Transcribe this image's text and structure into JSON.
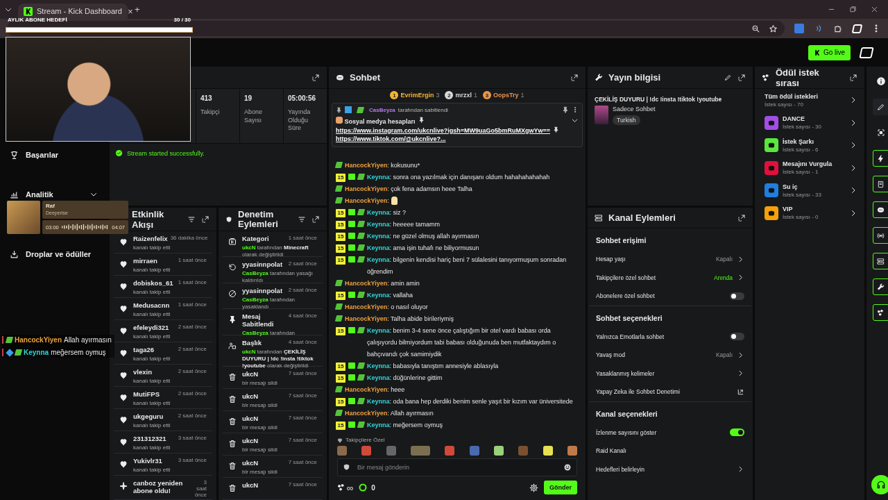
{
  "browser": {
    "tab_title": "Stream - Kick Dashboard",
    "tab_close": "×",
    "new_tab": "+"
  },
  "header": {
    "go_live": "Go live"
  },
  "overlays": {
    "goal": {
      "title": "AYLIK ABONE HEDEFİ",
      "count": "30 / 30",
      "level": 1
    },
    "music": {
      "title": "Raf",
      "artist": "Deeperise",
      "elapsed": "03:00",
      "total": "04:07"
    },
    "chat": [
      {
        "user": "HancockYiyen",
        "text": "Allah ayırmasın",
        "kind": "follower",
        "color": "#f0a23c"
      },
      {
        "user": "Keynna",
        "text": "meğersem oymuş",
        "kind": "subscriber",
        "color": "#33d6d6"
      }
    ]
  },
  "sidebar": {
    "items": [
      {
        "label": "Başarılar",
        "kind": "trophy",
        "expandable": false
      },
      {
        "label": "Analitik",
        "kind": "chart",
        "expandable": true
      },
      {
        "label": "Droplar ve ödüller",
        "kind": "drops",
        "expandable": false
      }
    ]
  },
  "stats": {
    "items": [
      {
        "value": "413",
        "label": "Takipçi"
      },
      {
        "value": "19",
        "label": "Abone Sayısı"
      },
      {
        "value": "05:00:56",
        "label": "Yayında Olduğu Süre"
      }
    ],
    "notice": "Stream started successfully."
  },
  "activity": {
    "title": "Etkinlik Akışı",
    "items": [
      {
        "kind": "follow",
        "name": "Raizenfelix",
        "desc": "kanalı takip etti",
        "time": "36 dakika önce"
      },
      {
        "kind": "follow",
        "name": "mirraen",
        "desc": "kanalı takip etti",
        "time": "1 saat önce"
      },
      {
        "kind": "follow",
        "name": "dobiskos_61",
        "desc": "kanalı takip etti",
        "time": "1 saat önce"
      },
      {
        "kind": "follow",
        "name": "Medusacnn",
        "desc": "kanalı takip etti",
        "time": "1 saat önce"
      },
      {
        "kind": "follow",
        "name": "efeleydi321",
        "desc": "kanalı takip etti",
        "time": "2 saat önce"
      },
      {
        "kind": "follow",
        "name": "taga26",
        "desc": "kanalı takip etti",
        "time": "2 saat önce"
      },
      {
        "kind": "follow",
        "name": "vlexin",
        "desc": "kanalı takip etti",
        "time": "2 saat önce"
      },
      {
        "kind": "follow",
        "name": "MutiFPS",
        "desc": "kanalı takip etti",
        "time": "2 saat önce"
      },
      {
        "kind": "follow",
        "name": "ukgeguru",
        "desc": "kanalı takip etti",
        "time": "2 saat önce"
      },
      {
        "kind": "follow",
        "name": "231312321",
        "desc": "kanalı takip etti",
        "time": "3 saat önce"
      },
      {
        "kind": "follow",
        "name": "Yukivlr31",
        "desc": "kanalı takip etti",
        "time": "3 saat önce"
      },
      {
        "kind": "resub",
        "name": "canboz yeniden abone oldu!",
        "time": "3 saat önce"
      }
    ]
  },
  "moderation": {
    "title": "Denetim Eylemleri",
    "items": [
      {
        "kind": "category",
        "title": "Kategori",
        "desc": "**ukcN** tarafından **Minecraft** olarak değiştirildi",
        "time": "1 saat önce"
      },
      {
        "kind": "unban",
        "title": "yyasinnpolat",
        "desc": "**CasBeyza** tarafından yasağı kaldırıldı",
        "time": "2 saat önce"
      },
      {
        "kind": "ban",
        "title": "yyasinnpolat",
        "desc": "**CasBeyza** tarafından yasaklandı",
        "time": "2 saat önce"
      },
      {
        "kind": "pin",
        "title": "Mesaj Sabitlendi",
        "desc": "**CasBeyza** tarafından",
        "time": "4 saat önce"
      },
      {
        "kind": "title",
        "title": "Başlık",
        "desc": "**ukcN** tarafından **ÇEKİLİŞ DUYURU | !dc !insta !tiktok !youtube** olarak değiştirildi",
        "time": "4 saat önce"
      },
      {
        "kind": "delete",
        "title": "ukcN",
        "desc": "bir mesajı sildi",
        "time": "7 saat önce"
      },
      {
        "kind": "delete",
        "title": "ukcN",
        "desc": "bir mesajı sildi",
        "time": "7 saat önce"
      },
      {
        "kind": "delete",
        "title": "ukcN",
        "desc": "bir mesajı sildi",
        "time": "7 saat önce"
      },
      {
        "kind": "delete",
        "title": "ukcN",
        "desc": "bir mesajı sildi",
        "time": "7 saat önce"
      },
      {
        "kind": "delete",
        "title": "ukcN",
        "desc": "bir mesajı sildi",
        "time": "7 saat önce"
      },
      {
        "kind": "delete",
        "title": "ukcN",
        "time": "7 saat önce"
      }
    ]
  },
  "chat": {
    "title": "Sohbet",
    "leaders": [
      {
        "rank": "1",
        "name": "EvrimErgin",
        "count": "3",
        "color": "#f5b731"
      },
      {
        "rank": "2",
        "name": "mrzxl",
        "count": "1",
        "color": "#d8d8d8"
      },
      {
        "rank": "3",
        "name": "OopsTry",
        "count": "1",
        "color": "#e8954a"
      }
    ],
    "pinned": {
      "by": "CasBeyza",
      "note": "tarafından sabitlendi",
      "label": "Sosyal medya hesapları",
      "links": [
        "https://www.instagram.com/ukcnlive?igsh=MW9uaGo5bmRuMXgwYw==",
        "https://www.tiktok.com/@ukcnlive?..."
      ]
    },
    "messages": [
      {
        "user": "HancockYiyen",
        "sep": ":",
        "text": "kokusunu*",
        "kind": "follower",
        "color": "#f0a23c"
      },
      {
        "badge": "15",
        "user": "Keynna",
        "sep": ":",
        "text": "sonra ona yazılmak için danışanı oldum hahahahahahah",
        "kind": "subscriber",
        "color": "#33d6d6"
      },
      {
        "user": "HancockYiyen",
        "sep": ":",
        "text": "çok fena adamsın heee Talha",
        "kind": "follower",
        "color": "#f0a23c"
      },
      {
        "user": "HancockYiyen",
        "sep": ":",
        "kind": "emote",
        "color": "#f0a23c"
      },
      {
        "badge": "15",
        "user": "Keynna",
        "sep": ":",
        "text": "siz ?",
        "kind": "subscriber",
        "color": "#33d6d6"
      },
      {
        "badge": "15",
        "user": "Keynna",
        "sep": ":",
        "text": "heeeee tamamm",
        "kind": "subscriber",
        "color": "#33d6d6"
      },
      {
        "badge": "15",
        "user": "Keynna",
        "sep": ":",
        "text": "ne güzel olmuş allah ayırmasın",
        "kind": "subscriber",
        "color": "#33d6d6"
      },
      {
        "badge": "15",
        "user": "Keynna",
        "sep": ":",
        "text": "ama işin tuhafı ne biliyormusun",
        "kind": "subscriber",
        "color": "#33d6d6"
      },
      {
        "badge": "15",
        "user": "Keynna",
        "sep": ":",
        "text": "bilgenin kendisi hariç beni 7 sülalesini tanıyormuşum sonradan öğrendim",
        "kind": "subscriber",
        "color": "#33d6d6"
      },
      {
        "user": "HancockYiyen",
        "sep": ":",
        "text": "amin amin",
        "kind": "follower",
        "color": "#f0a23c"
      },
      {
        "badge": "15",
        "user": "Keynna",
        "sep": ":",
        "text": "vallaha",
        "kind": "subscriber",
        "color": "#33d6d6"
      },
      {
        "user": "HancockYiyen",
        "sep": ":",
        "text": "o nasıl oluyor",
        "kind": "follower",
        "color": "#f0a23c"
      },
      {
        "user": "HancockYiyen",
        "sep": ":",
        "text": "Talha abide birileriymiş",
        "kind": "follower",
        "color": "#f0a23c"
      },
      {
        "badge": "15",
        "user": "Keynna",
        "sep": ":",
        "text": "benim 3-4 sene önce çalıştığım bir otel vardı babası orda çalışıyordu bilmiyordum tabi babası olduğunuda ben mutfaktaydım o bahçıvandı çok samimiydik",
        "kind": "subscriber",
        "color": "#33d6d6"
      },
      {
        "badge": "15",
        "user": "Keynna",
        "sep": ":",
        "text": "babasıyla tanıştım annesiyle ablasıyla",
        "kind": "subscriber",
        "color": "#33d6d6"
      },
      {
        "badge": "15",
        "user": "Keynna",
        "sep": ":",
        "text": "düğünlerine gittim",
        "kind": "subscriber",
        "color": "#33d6d6"
      },
      {
        "user": "HancockYiyen",
        "sep": ":",
        "text": "heee",
        "kind": "follower",
        "color": "#f0a23c"
      },
      {
        "badge": "15",
        "user": "Keynna",
        "sep": ":",
        "text": "oda bana hep derdiki benim senle yaşıt bir kızım var üniversitede",
        "kind": "subscriber",
        "color": "#33d6d6"
      },
      {
        "user": "HancockYiyen",
        "sep": ":",
        "text": "Allah ayırmasın",
        "kind": "follower",
        "color": "#f0a23c"
      },
      {
        "badge": "15",
        "user": "Keynna",
        "sep": ":",
        "text": "meğersem oymuş",
        "kind": "subscriber",
        "color": "#33d6d6"
      }
    ],
    "emote_label": "Takipçilere Özel",
    "placeholder": "Bir mesaj gönderin",
    "infinity": "∞",
    "points": "0",
    "send": "Gönder"
  },
  "stream_info": {
    "title": "Yayın bilgisi",
    "stream_title": "ÇEKİLİŞ DUYURU | !dc !insta !tiktok !youtube",
    "category": "Sadece Sohbet",
    "tag": "Turkish"
  },
  "channel_actions": {
    "title": "Kanal Eylemleri",
    "sections": [
      {
        "heading": "Sohbet erişimi",
        "rows": [
          {
            "kind": "select",
            "label": "Hesap yaşı",
            "value": "Kapalı",
            "accent": false
          },
          {
            "kind": "select",
            "label": "Takipçilere özel sohbet",
            "value": "Anında",
            "accent": true
          },
          {
            "kind": "toggle",
            "label": "Abonelere özel sohbet",
            "on": false
          }
        ]
      },
      {
        "heading": "Sohbet seçenekleri",
        "rows": [
          {
            "kind": "toggle",
            "label": "Yalnızca Emotlarla sohbet",
            "on": false
          },
          {
            "kind": "select",
            "label": "Yavaş mod",
            "value": "Kapalı",
            "accent": false
          },
          {
            "kind": "nav",
            "label": "Yasaklanmış kelimeler"
          },
          {
            "kind": "external",
            "label": "Yapay Zeka ile Sohbet Denetimi"
          }
        ]
      },
      {
        "heading": "Kanal seçenekleri",
        "rows": [
          {
            "kind": "toggle",
            "label": "İzlenme sayısını göster",
            "on": true
          },
          {
            "kind": "plain",
            "label": "Raid Kanalı"
          },
          {
            "kind": "nav",
            "label": "Hedefleri belirleyin"
          }
        ]
      }
    ]
  },
  "rewards": {
    "title": "Ödül istek sırası",
    "items": [
      {
        "title": "Tüm ödül istekleri",
        "count": "İstek sayısı - 70"
      },
      {
        "title": "DANCE",
        "count": "İstek sayısı - 30",
        "color": "#a24ee6"
      },
      {
        "title": "İstek Şarkı",
        "count": "İstek sayısı - 6",
        "color": "#5ae63c"
      },
      {
        "title": "Mesajını Vurgula",
        "count": "İstek sayısı - 1",
        "color": "#e0103c"
      },
      {
        "title": "Su iç",
        "count": "İstek sayısı - 33",
        "color": "#1f7fe0"
      },
      {
        "title": "VIP",
        "count": "İstek sayısı - 0",
        "color": "#f5a00a"
      }
    ]
  }
}
